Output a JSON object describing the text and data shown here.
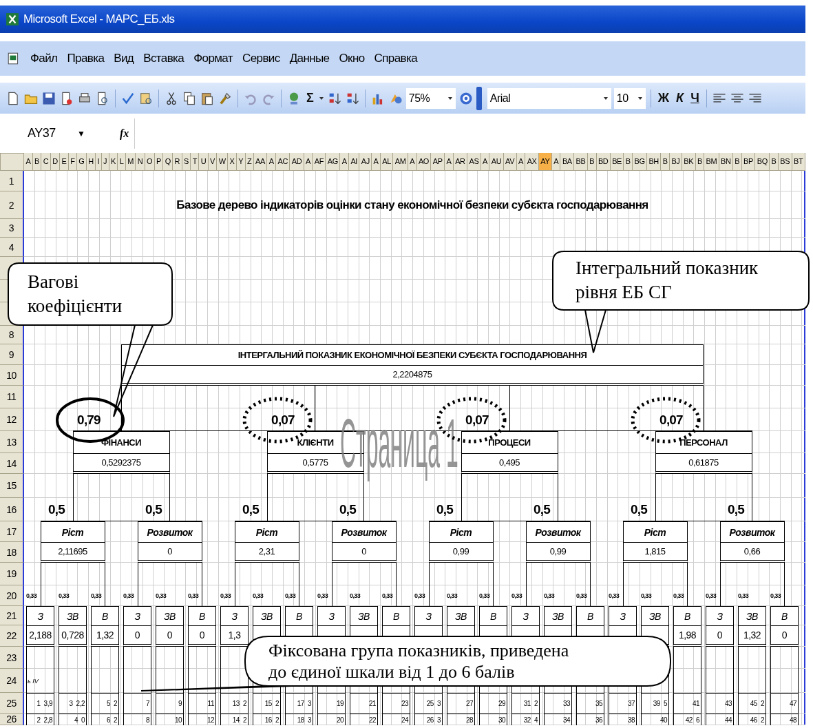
{
  "window": {
    "title": "Microsoft Excel - МАРС_ЕБ.xls"
  },
  "menu": [
    "Файл",
    "Правка",
    "Вид",
    "Вставка",
    "Формат",
    "Сервис",
    "Данные",
    "Окно",
    "Справка"
  ],
  "toolbar": {
    "sum": "Σ",
    "zoom": "75%",
    "font": "Arial",
    "font_size": "10",
    "bold": "Ж",
    "italic": "К",
    "underline": "Ч"
  },
  "formula_bar": {
    "cell": "AY37",
    "dropdown": "▼",
    "function_label": "fx"
  },
  "columns": [
    {
      "label": "A",
      "selected": false
    },
    {
      "label": "B",
      "selected": false
    },
    {
      "label": "C",
      "selected": false
    },
    {
      "label": "D",
      "selected": false
    },
    {
      "label": "E",
      "selected": false
    },
    {
      "label": "F",
      "selected": false
    },
    {
      "label": "G",
      "selected": false
    },
    {
      "label": "H",
      "selected": false
    },
    {
      "label": "I",
      "selected": false
    },
    {
      "label": "J",
      "selected": false
    },
    {
      "label": "K",
      "selected": false
    },
    {
      "label": "L",
      "selected": false
    },
    {
      "label": "M",
      "selected": false
    },
    {
      "label": "N",
      "selected": false
    },
    {
      "label": "O",
      "selected": false
    },
    {
      "label": "P",
      "selected": false
    },
    {
      "label": "Q",
      "selected": false
    },
    {
      "label": "R",
      "selected": false
    },
    {
      "label": "S",
      "selected": false
    },
    {
      "label": "T",
      "selected": false
    },
    {
      "label": "U",
      "selected": false
    },
    {
      "label": "V",
      "selected": false
    },
    {
      "label": "W",
      "selected": false
    },
    {
      "label": "X",
      "selected": false
    },
    {
      "label": "Y",
      "selected": false
    },
    {
      "label": "Z",
      "selected": false
    },
    {
      "label": "AA",
      "selected": false
    },
    {
      "label": "A",
      "selected": false
    },
    {
      "label": "AC",
      "selected": false
    },
    {
      "label": "AD",
      "selected": false
    },
    {
      "label": "A",
      "selected": false
    },
    {
      "label": "AF",
      "selected": false
    },
    {
      "label": "AG",
      "selected": false
    },
    {
      "label": "A",
      "selected": false
    },
    {
      "label": "AI",
      "selected": false
    },
    {
      "label": "AJ",
      "selected": false
    },
    {
      "label": "A",
      "selected": false
    },
    {
      "label": "AL",
      "selected": false
    },
    {
      "label": "AM",
      "selected": false
    },
    {
      "label": "A",
      "selected": false
    },
    {
      "label": "AO",
      "selected": false
    },
    {
      "label": "AP",
      "selected": false
    },
    {
      "label": "A",
      "selected": false
    },
    {
      "label": "AR",
      "selected": false
    },
    {
      "label": "AS",
      "selected": false
    },
    {
      "label": "A",
      "selected": false
    },
    {
      "label": "AU",
      "selected": false
    },
    {
      "label": "AV",
      "selected": false
    },
    {
      "label": "A",
      "selected": false
    },
    {
      "label": "AX",
      "selected": false
    },
    {
      "label": "AY",
      "selected": true
    },
    {
      "label": "A",
      "selected": false
    },
    {
      "label": "BA",
      "selected": false
    },
    {
      "label": "BB",
      "selected": false
    },
    {
      "label": "B",
      "selected": false
    },
    {
      "label": "BD",
      "selected": false
    },
    {
      "label": "BE",
      "selected": false
    },
    {
      "label": "B",
      "selected": false
    },
    {
      "label": "BG",
      "selected": false
    },
    {
      "label": "BH",
      "selected": false
    },
    {
      "label": "B",
      "selected": false
    },
    {
      "label": "BJ",
      "selected": false
    },
    {
      "label": "BK",
      "selected": false
    },
    {
      "label": "B",
      "selected": false
    },
    {
      "label": "BM",
      "selected": false
    },
    {
      "label": "BN",
      "selected": false
    },
    {
      "label": "B",
      "selected": false
    },
    {
      "label": "BP",
      "selected": false
    },
    {
      "label": "BQ",
      "selected": false
    },
    {
      "label": "B",
      "selected": false
    },
    {
      "label": "BS",
      "selected": false
    },
    {
      "label": "BT",
      "selected": false
    }
  ],
  "rows": [
    {
      "label": "1"
    },
    {
      "label": "2"
    },
    {
      "label": "3"
    },
    {
      "label": "4"
    },
    {
      "label": "8"
    },
    {
      "label": "9"
    },
    {
      "label": "10"
    },
    {
      "label": "11"
    },
    {
      "label": "12"
    },
    {
      "label": "13"
    },
    {
      "label": "14"
    },
    {
      "label": "15"
    },
    {
      "label": "16"
    },
    {
      "label": "17"
    },
    {
      "label": "18"
    },
    {
      "label": "19"
    },
    {
      "label": "20"
    },
    {
      "label": "21"
    },
    {
      "label": "22"
    },
    {
      "label": "23"
    },
    {
      "label": "24"
    },
    {
      "label": "25"
    },
    {
      "label": "26"
    }
  ],
  "title": "Базове дерево індикаторів оцінки стану економічної безпеки субєкта господарювання",
  "root": {
    "label": "ІНТЕРГАЛЬНИЙ ПОКАЗНИК ЕКОНОМІЧНОЇ БЕЗПЕКИ СУБЄКТА ГОСПОДАРЮВАННЯ",
    "value": "2,2204875"
  },
  "groups": [
    {
      "weight": "0,79",
      "dotted_circle": false,
      "label": "ФІНАНСИ",
      "value": "0,5292375",
      "subgroups": [
        {
          "weight": "0,5",
          "label": "Ріст",
          "value": "2,11695",
          "leaves": [
            {
              "weight": "0,33",
              "label": "З",
              "value": "2,188",
              "row25": [
                "1",
                "3,9"
              ],
              "row26": [
                "2",
                "2,8"
              ]
            },
            {
              "weight": "0,33",
              "label": "ЗВ",
              "value": "0,728",
              "row25": [
                "3",
                "2,2"
              ],
              "row26": [
                "4",
                "0"
              ]
            },
            {
              "weight": "0,33",
              "label": "В",
              "value": "1,32",
              "row25": [
                "5",
                "2"
              ],
              "row26": [
                "6",
                "2"
              ]
            }
          ]
        },
        {
          "weight": "0,5",
          "label": "Розвиток",
          "value": "0",
          "leaves": [
            {
              "weight": "0,33",
              "label": "З",
              "value": "0",
              "row25": [
                "7"
              ],
              "row26": [
                "8"
              ]
            },
            {
              "weight": "0,33",
              "label": "ЗВ",
              "value": "0",
              "row25": [
                "9"
              ],
              "row26": [
                "10"
              ]
            },
            {
              "weight": "0,33",
              "label": "В",
              "value": "0",
              "row25": [
                "11"
              ],
              "row26": [
                "12"
              ]
            }
          ]
        }
      ]
    },
    {
      "weight": "0,07",
      "dotted_circle": true,
      "label": "КЛІЄНТИ",
      "value": "0,5775",
      "subgroups": [
        {
          "weight": "0,5",
          "label": "Ріст",
          "value": "2,31",
          "leaves": [
            {
              "weight": "0,33",
              "label": "З",
              "value": "1,3",
              "row25": [
                "13",
                "2"
              ],
              "row26": [
                "14",
                "2"
              ]
            },
            {
              "weight": "0,33",
              "label": "ЗВ",
              "row25": [
                "15",
                "2"
              ],
              "row26": [
                "16",
                "2"
              ]
            },
            {
              "weight": "0,33",
              "label": "В",
              "row25": [
                "17",
                "3"
              ],
              "row26": [
                "18",
                "3"
              ]
            }
          ]
        },
        {
          "weight": "0,5",
          "label": "Розвиток",
          "value": "0",
          "leaves": [
            {
              "weight": "0,33",
              "label": "З",
              "row25": [
                "19"
              ],
              "row26": [
                "20"
              ]
            },
            {
              "weight": "0,33",
              "label": "ЗВ",
              "row25": [
                "21"
              ],
              "row26": [
                "22"
              ]
            },
            {
              "weight": "0,33",
              "label": "В",
              "row25": [
                "23"
              ],
              "row26": [
                "24"
              ]
            }
          ]
        }
      ]
    },
    {
      "weight": "0,07",
      "dotted_circle": true,
      "label": "ПРОЦЕСИ",
      "value": "0,495",
      "subgroups": [
        {
          "weight": "0,5",
          "label": "Ріст",
          "value": "0,99",
          "leaves": [
            {
              "weight": "0,33",
              "label": "З",
              "row25": [
                "25",
                "3"
              ],
              "row26": [
                "26",
                "3"
              ]
            },
            {
              "weight": "0,33",
              "label": "ЗВ",
              "row25": [
                "27"
              ],
              "row26": [
                "28"
              ]
            },
            {
              "weight": "0,33",
              "label": "В",
              "row25": [
                "29"
              ],
              "row26": [
                "30"
              ]
            }
          ]
        },
        {
          "weight": "0,5",
          "label": "Розвиток",
          "value": "0,99",
          "leaves": [
            {
              "weight": "0,33",
              "label": "З",
              "row25": [
                "31",
                "2"
              ],
              "row26": [
                "32",
                "4"
              ]
            },
            {
              "weight": "0,33",
              "label": "ЗВ",
              "row25": [
                "33"
              ],
              "row26": [
                "34"
              ]
            },
            {
              "weight": "0,33",
              "label": "В",
              "row25": [
                "35"
              ],
              "row26": [
                "36"
              ]
            }
          ]
        }
      ]
    },
    {
      "weight": "0,07",
      "dotted_circle": true,
      "label": "ПЕРСОНАЛ",
      "value": "0,61875",
      "subgroups": [
        {
          "weight": "0,5",
          "label": "Ріст",
          "value": "1,815",
          "leaves": [
            {
              "weight": "0,33",
              "label": "З",
              "row25": [
                "37"
              ],
              "row26": [
                "38"
              ]
            },
            {
              "weight": "0,33",
              "label": "ЗВ",
              "row25": [
                "39",
                "5"
              ],
              "row26": [
                "40"
              ]
            },
            {
              "weight": "0,33",
              "label": "В",
              "value": "1,98",
              "row25": [
                "41"
              ],
              "row26": [
                "42",
                "6"
              ]
            }
          ]
        },
        {
          "weight": "0,5",
          "label": "Розвиток",
          "value": "0,66",
          "leaves": [
            {
              "weight": "0,33",
              "label": "З",
              "value": "0",
              "row25": [
                "43"
              ],
              "row26": [
                "44"
              ]
            },
            {
              "weight": "0,33",
              "label": "ЗВ",
              "value": "1,32",
              "row25": [
                "45",
                "2"
              ],
              "row26": [
                "46",
                "2"
              ]
            },
            {
              "weight": "0,33",
              "label": "В",
              "value": "0",
              "row25": [
                "47"
              ],
              "row26": [
                "48"
              ]
            }
          ]
        }
      ]
    }
  ],
  "row24_note": "ь IV",
  "page_label": "Страница 1",
  "callouts": [
    {
      "text": "Вагові коефіцієнти"
    },
    {
      "text": "Інтегральний показник рівня ЕБ СГ"
    },
    {
      "text": "Фіксована група показників, приведена до єдиної шкали від 1 до 6 балів"
    }
  ]
}
